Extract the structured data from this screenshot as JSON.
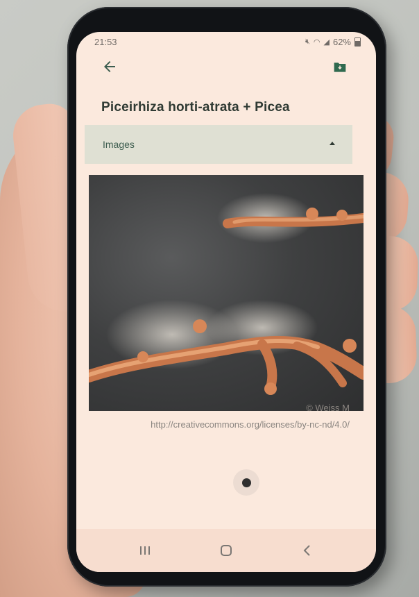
{
  "status_bar": {
    "time": "21:53",
    "battery": "62%"
  },
  "app_bar": {
    "back_icon": "arrow-back-icon",
    "save_icon": "folder-download-icon"
  },
  "page": {
    "title": "Piceirhiza horti-atrata + Picea"
  },
  "section": {
    "label": "Images",
    "expanded": true
  },
  "image": {
    "credit": "© Weiss M",
    "license": "http://creativecommons.org/licenses/by-nc-nd/4.0/"
  },
  "pager": {
    "current": 1,
    "total": 1
  },
  "nav_bar": {
    "icons": [
      "recent-apps-icon",
      "home-icon",
      "back-nav-icon"
    ]
  },
  "colors": {
    "screen_bg": "#fbe9dd",
    "section_bg": "#dfe0d3",
    "accent_green": "#3d5d4f"
  }
}
